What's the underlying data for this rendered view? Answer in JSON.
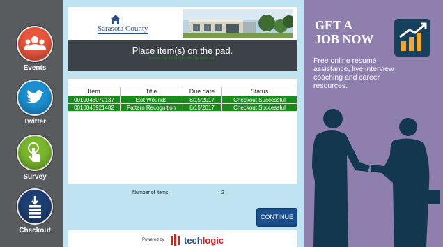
{
  "sidebar": {
    "items": [
      {
        "label": "Events"
      },
      {
        "label": "Twitter"
      },
      {
        "label": "Survey"
      },
      {
        "label": "Checkout"
      }
    ]
  },
  "header": {
    "county_name": "Sarasota County",
    "prompt": "Place item(s) on the pad.",
    "prompt_sub": "Select the item(s) to be checked out."
  },
  "table": {
    "columns": [
      "Item",
      "Title",
      "Due date",
      "Status"
    ],
    "rows": [
      {
        "item": "0010046072137",
        "title": "Exit Wounds",
        "due": "8/15/2017",
        "status": "Checkout Successful"
      },
      {
        "item": "0010045921482",
        "title": "Pattern Recognition",
        "due": "8/15/2017",
        "status": "Checkout Successful"
      }
    ]
  },
  "summary": {
    "count_label": "Number of items:",
    "count_value": "2"
  },
  "actions": {
    "continue_label": "CONTINUE"
  },
  "footer": {
    "powered_by": "Powered by",
    "brand_tech": "tech",
    "brand_logic": "logic"
  },
  "ad": {
    "title_line1": "GET A",
    "title_line2": "JOB NOW",
    "body": "Free online resumé assistance, live interview coaching and career resources."
  },
  "colors": {
    "sidebar_bg": "#595c5f",
    "panel_bg": "#bfe3f0",
    "prompt_bar": "#3c4247",
    "row_success": "#1a8a1a",
    "button": "#1b4f8c",
    "ad_bg": "#8e7fae",
    "silhouette": "#13374f"
  },
  "icons": [
    "people-icon",
    "bird-icon",
    "touch-hand-icon",
    "book-stack-icon",
    "chart-arrow-icon"
  ]
}
